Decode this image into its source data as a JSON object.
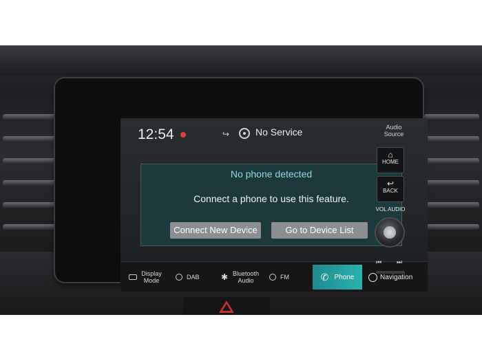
{
  "status": {
    "time": "12:54",
    "service": "No Service",
    "audio_source": "Audio Source"
  },
  "dialog": {
    "title": "No phone detected",
    "message": "Connect a phone to use this feature.",
    "connect_button": "Connect New Device",
    "device_list_button": "Go to Device List"
  },
  "bottom_bar": {
    "display_mode": "Display Mode",
    "dab": "DAB",
    "bluetooth_audio": "Bluetooth Audio",
    "fm": "FM",
    "phone": "Phone",
    "navigation": "Navigation"
  },
  "hardware": {
    "home": "HOME",
    "back": "BACK",
    "vol_audio": "VOL AUDIO"
  },
  "colors": {
    "dialog_title": "#8ed8e0",
    "phone_tab": "#29b3b0",
    "notification": "#d8403a"
  }
}
